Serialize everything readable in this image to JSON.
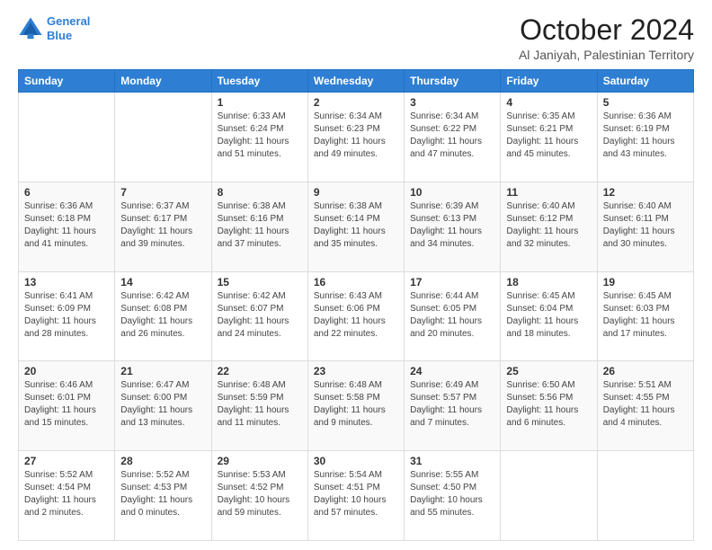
{
  "header": {
    "logo_line1": "General",
    "logo_line2": "Blue",
    "month": "October 2024",
    "location": "Al Janiyah, Palestinian Territory"
  },
  "days_of_week": [
    "Sunday",
    "Monday",
    "Tuesday",
    "Wednesday",
    "Thursday",
    "Friday",
    "Saturday"
  ],
  "weeks": [
    [
      {
        "day": "",
        "info": ""
      },
      {
        "day": "",
        "info": ""
      },
      {
        "day": "1",
        "info": "Sunrise: 6:33 AM\nSunset: 6:24 PM\nDaylight: 11 hours and 51 minutes."
      },
      {
        "day": "2",
        "info": "Sunrise: 6:34 AM\nSunset: 6:23 PM\nDaylight: 11 hours and 49 minutes."
      },
      {
        "day": "3",
        "info": "Sunrise: 6:34 AM\nSunset: 6:22 PM\nDaylight: 11 hours and 47 minutes."
      },
      {
        "day": "4",
        "info": "Sunrise: 6:35 AM\nSunset: 6:21 PM\nDaylight: 11 hours and 45 minutes."
      },
      {
        "day": "5",
        "info": "Sunrise: 6:36 AM\nSunset: 6:19 PM\nDaylight: 11 hours and 43 minutes."
      }
    ],
    [
      {
        "day": "6",
        "info": "Sunrise: 6:36 AM\nSunset: 6:18 PM\nDaylight: 11 hours and 41 minutes."
      },
      {
        "day": "7",
        "info": "Sunrise: 6:37 AM\nSunset: 6:17 PM\nDaylight: 11 hours and 39 minutes."
      },
      {
        "day": "8",
        "info": "Sunrise: 6:38 AM\nSunset: 6:16 PM\nDaylight: 11 hours and 37 minutes."
      },
      {
        "day": "9",
        "info": "Sunrise: 6:38 AM\nSunset: 6:14 PM\nDaylight: 11 hours and 35 minutes."
      },
      {
        "day": "10",
        "info": "Sunrise: 6:39 AM\nSunset: 6:13 PM\nDaylight: 11 hours and 34 minutes."
      },
      {
        "day": "11",
        "info": "Sunrise: 6:40 AM\nSunset: 6:12 PM\nDaylight: 11 hours and 32 minutes."
      },
      {
        "day": "12",
        "info": "Sunrise: 6:40 AM\nSunset: 6:11 PM\nDaylight: 11 hours and 30 minutes."
      }
    ],
    [
      {
        "day": "13",
        "info": "Sunrise: 6:41 AM\nSunset: 6:09 PM\nDaylight: 11 hours and 28 minutes."
      },
      {
        "day": "14",
        "info": "Sunrise: 6:42 AM\nSunset: 6:08 PM\nDaylight: 11 hours and 26 minutes."
      },
      {
        "day": "15",
        "info": "Sunrise: 6:42 AM\nSunset: 6:07 PM\nDaylight: 11 hours and 24 minutes."
      },
      {
        "day": "16",
        "info": "Sunrise: 6:43 AM\nSunset: 6:06 PM\nDaylight: 11 hours and 22 minutes."
      },
      {
        "day": "17",
        "info": "Sunrise: 6:44 AM\nSunset: 6:05 PM\nDaylight: 11 hours and 20 minutes."
      },
      {
        "day": "18",
        "info": "Sunrise: 6:45 AM\nSunset: 6:04 PM\nDaylight: 11 hours and 18 minutes."
      },
      {
        "day": "19",
        "info": "Sunrise: 6:45 AM\nSunset: 6:03 PM\nDaylight: 11 hours and 17 minutes."
      }
    ],
    [
      {
        "day": "20",
        "info": "Sunrise: 6:46 AM\nSunset: 6:01 PM\nDaylight: 11 hours and 15 minutes."
      },
      {
        "day": "21",
        "info": "Sunrise: 6:47 AM\nSunset: 6:00 PM\nDaylight: 11 hours and 13 minutes."
      },
      {
        "day": "22",
        "info": "Sunrise: 6:48 AM\nSunset: 5:59 PM\nDaylight: 11 hours and 11 minutes."
      },
      {
        "day": "23",
        "info": "Sunrise: 6:48 AM\nSunset: 5:58 PM\nDaylight: 11 hours and 9 minutes."
      },
      {
        "day": "24",
        "info": "Sunrise: 6:49 AM\nSunset: 5:57 PM\nDaylight: 11 hours and 7 minutes."
      },
      {
        "day": "25",
        "info": "Sunrise: 6:50 AM\nSunset: 5:56 PM\nDaylight: 11 hours and 6 minutes."
      },
      {
        "day": "26",
        "info": "Sunrise: 5:51 AM\nSunset: 4:55 PM\nDaylight: 11 hours and 4 minutes."
      }
    ],
    [
      {
        "day": "27",
        "info": "Sunrise: 5:52 AM\nSunset: 4:54 PM\nDaylight: 11 hours and 2 minutes."
      },
      {
        "day": "28",
        "info": "Sunrise: 5:52 AM\nSunset: 4:53 PM\nDaylight: 11 hours and 0 minutes."
      },
      {
        "day": "29",
        "info": "Sunrise: 5:53 AM\nSunset: 4:52 PM\nDaylight: 10 hours and 59 minutes."
      },
      {
        "day": "30",
        "info": "Sunrise: 5:54 AM\nSunset: 4:51 PM\nDaylight: 10 hours and 57 minutes."
      },
      {
        "day": "31",
        "info": "Sunrise: 5:55 AM\nSunset: 4:50 PM\nDaylight: 10 hours and 55 minutes."
      },
      {
        "day": "",
        "info": ""
      },
      {
        "day": "",
        "info": ""
      }
    ]
  ]
}
